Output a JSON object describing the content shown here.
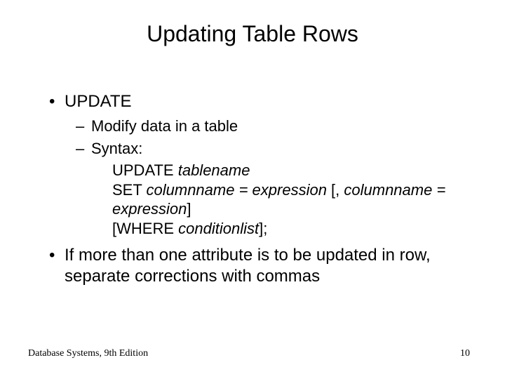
{
  "title": "Updating Table Rows",
  "bullets": {
    "b1a": "UPDATE",
    "b2a": "Modify data in a table",
    "b2b": "Syntax:",
    "b1b": "If more than one attribute is to be updated in row, separate corrections with commas"
  },
  "syntax": {
    "l1_plain": "UPDATE ",
    "l1_ital": "tablename",
    "l2_plain1": "SET ",
    "l2_ital1": "columnname = expression",
    "l2_plain2": " [, ",
    "l2_ital2": "columnname = expression",
    "l2_plain3": "]",
    "l3_plain1": "[WHERE ",
    "l3_ital": "conditionlist",
    "l3_plain2": "];"
  },
  "footer": {
    "left": "Database Systems, 9th Edition",
    "right": "10"
  }
}
